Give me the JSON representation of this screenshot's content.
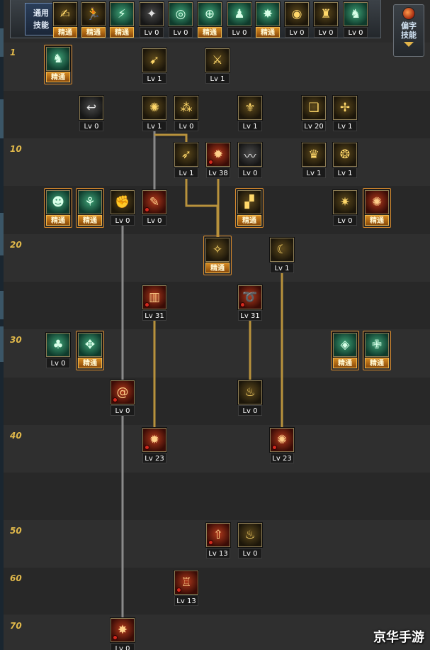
{
  "tabs": {
    "common_skills": "通用\n技能",
    "side_skills_line1": "偏字",
    "side_skills_line2": "技能"
  },
  "master_label": "精通",
  "level_labels": [
    "1",
    "10",
    "20",
    "30",
    "40",
    "50",
    "60",
    "70"
  ],
  "top_bar_skills": [
    {
      "icon": "pose-icon",
      "glyph": "✍",
      "tone": "gold",
      "caption": "精通"
    },
    {
      "icon": "run-icon",
      "glyph": "🏃",
      "tone": "gold",
      "caption": "精通"
    },
    {
      "icon": "dash-icon",
      "glyph": "⚡",
      "tone": "green",
      "caption": "精通"
    },
    {
      "icon": "wing-icon",
      "glyph": "✦",
      "tone": "gray",
      "caption": "Lv 0"
    },
    {
      "icon": "target-icon",
      "glyph": "◎",
      "tone": "green",
      "caption": "Lv 0"
    },
    {
      "icon": "crosshair-icon",
      "glyph": "⊕",
      "tone": "green",
      "caption": "精通"
    },
    {
      "icon": "figure-icon",
      "glyph": "♟",
      "tone": "green",
      "caption": "Lv 0"
    },
    {
      "icon": "burst-icon",
      "glyph": "✸",
      "tone": "green",
      "caption": "精通"
    },
    {
      "icon": "eye-icon",
      "glyph": "◉",
      "tone": "gold",
      "caption": "Lv 0"
    },
    {
      "icon": "warrior-icon",
      "glyph": "♜",
      "tone": "gold",
      "caption": "Lv 0"
    },
    {
      "icon": "stance-icon",
      "glyph": "♞",
      "tone": "green",
      "caption": "Lv 0"
    }
  ],
  "tree_skills": [
    {
      "id": "s1",
      "icon": "ninja-icon",
      "glyph": "♞",
      "tone": "green",
      "caption": "精通",
      "badge": false,
      "boxed": true
    },
    {
      "id": "s2",
      "icon": "blast-icon",
      "glyph": "➹",
      "tone": "gold",
      "caption": "Lv 1",
      "badge": false
    },
    {
      "id": "s3",
      "icon": "spear-icon",
      "glyph": "⚔",
      "tone": "gold",
      "caption": "Lv 1",
      "badge": false
    },
    {
      "id": "s4",
      "icon": "hook-icon",
      "glyph": "↩",
      "tone": "gray",
      "caption": "Lv 0",
      "badge": false
    },
    {
      "id": "s5",
      "icon": "vortex-icon",
      "glyph": "✺",
      "tone": "gold",
      "caption": "Lv 1",
      "badge": false
    },
    {
      "id": "s6",
      "icon": "orbs-icon",
      "glyph": "⁂",
      "tone": "gold",
      "caption": "Lv 0",
      "badge": false
    },
    {
      "id": "s7",
      "icon": "emblem-icon",
      "glyph": "⚜",
      "tone": "gold",
      "caption": "Lv 1",
      "badge": false
    },
    {
      "id": "s8",
      "icon": "book-icon",
      "glyph": "❏",
      "tone": "gold",
      "caption": "Lv 20",
      "badge": false
    },
    {
      "id": "s9",
      "icon": "knot-icon",
      "glyph": "✢",
      "tone": "gold",
      "caption": "Lv 1",
      "badge": false
    },
    {
      "id": "s10",
      "icon": "kick-icon",
      "glyph": "➶",
      "tone": "gold",
      "caption": "Lv 1",
      "badge": false
    },
    {
      "id": "s11",
      "icon": "flame-strike-icon",
      "glyph": "✹",
      "tone": "red",
      "caption": "Lv 38",
      "badge": true
    },
    {
      "id": "s12",
      "icon": "whip-icon",
      "glyph": "〰",
      "tone": "gray",
      "caption": "Lv 0",
      "badge": false
    },
    {
      "id": "s13",
      "icon": "witch-icon",
      "glyph": "♛",
      "tone": "gold",
      "caption": "Lv 1",
      "badge": false
    },
    {
      "id": "s14",
      "icon": "spiral-icon",
      "glyph": "❂",
      "tone": "gold",
      "caption": "Lv 1",
      "badge": false
    },
    {
      "id": "s15",
      "icon": "head-icon",
      "glyph": "☻",
      "tone": "green",
      "caption": "精通",
      "badge": false,
      "boxed": true
    },
    {
      "id": "s16",
      "icon": "sprint-icon",
      "glyph": "⚘",
      "tone": "green",
      "caption": "精通",
      "badge": false,
      "boxed": true
    },
    {
      "id": "s17",
      "icon": "fist-icon",
      "glyph": "✊",
      "tone": "gold",
      "caption": "Lv 0",
      "badge": false
    },
    {
      "id": "s18",
      "icon": "dagger-icon",
      "glyph": "✎",
      "tone": "red",
      "caption": "Lv 0",
      "badge": true
    },
    {
      "id": "s19",
      "icon": "doorway-icon",
      "glyph": "▞",
      "tone": "gold",
      "caption": "精通",
      "badge": false,
      "boxed": true
    },
    {
      "id": "s20",
      "icon": "shockwave-icon",
      "glyph": "✷",
      "tone": "gold",
      "caption": "Lv 0",
      "badge": false
    },
    {
      "id": "s21",
      "icon": "fireball-icon",
      "glyph": "✺",
      "tone": "red",
      "caption": "精通",
      "badge": false,
      "boxed": true
    },
    {
      "id": "s22",
      "icon": "sparkle-icon",
      "glyph": "✧",
      "tone": "gold",
      "caption": "精通",
      "badge": false,
      "boxed": true
    },
    {
      "id": "s23",
      "icon": "ring-icon",
      "glyph": "☾",
      "tone": "gold",
      "caption": "Lv 1",
      "badge": false
    },
    {
      "id": "s24",
      "icon": "pillar-icon",
      "glyph": "▥",
      "tone": "red",
      "caption": "Lv 31",
      "badge": true
    },
    {
      "id": "s25",
      "icon": "dragon-icon",
      "glyph": "➰",
      "tone": "red",
      "caption": "Lv 31",
      "badge": true
    },
    {
      "id": "s26",
      "icon": "tree-icon",
      "glyph": "♣",
      "tone": "green",
      "caption": "Lv 0",
      "badge": false
    },
    {
      "id": "s27",
      "icon": "compass-icon",
      "glyph": "✥",
      "tone": "green",
      "caption": "精通",
      "badge": false,
      "boxed": true
    },
    {
      "id": "s28",
      "icon": "shield-icon",
      "glyph": "◈",
      "tone": "green",
      "caption": "精通",
      "badge": false,
      "boxed": true
    },
    {
      "id": "s29",
      "icon": "cross-icon",
      "glyph": "✙",
      "tone": "green",
      "caption": "精通",
      "badge": false,
      "boxed": true
    },
    {
      "id": "s30",
      "icon": "swirl-icon",
      "glyph": "@",
      "tone": "red",
      "caption": "Lv 0",
      "badge": true
    },
    {
      "id": "s31",
      "icon": "bonfire-icon",
      "glyph": "♨",
      "tone": "gold",
      "caption": "Lv 0",
      "badge": false
    },
    {
      "id": "s32",
      "icon": "inferno-icon",
      "glyph": "✹",
      "tone": "red",
      "caption": "Lv 23",
      "badge": true
    },
    {
      "id": "s33",
      "icon": "whirlwind-icon",
      "glyph": "✺",
      "tone": "red",
      "caption": "Lv 23",
      "badge": true
    },
    {
      "id": "s34",
      "icon": "eruption-icon",
      "glyph": "⇧",
      "tone": "red",
      "caption": "Lv 13",
      "badge": true
    },
    {
      "id": "s35",
      "icon": "flames-icon",
      "glyph": "♨",
      "tone": "gold",
      "caption": "Lv 0",
      "badge": false
    },
    {
      "id": "s36",
      "icon": "fortress-icon",
      "glyph": "♖",
      "tone": "red",
      "caption": "Lv 13",
      "badge": true
    },
    {
      "id": "s37",
      "icon": "explosion-icon",
      "glyph": "✸",
      "tone": "red",
      "caption": "Lv 0",
      "badge": true
    }
  ],
  "colors": {
    "accent": "#e0b84a",
    "link_gold": "#b8923c",
    "link_gray": "#8a8a8a",
    "master_orange": "#d58a22"
  },
  "watermark": "京华手游"
}
